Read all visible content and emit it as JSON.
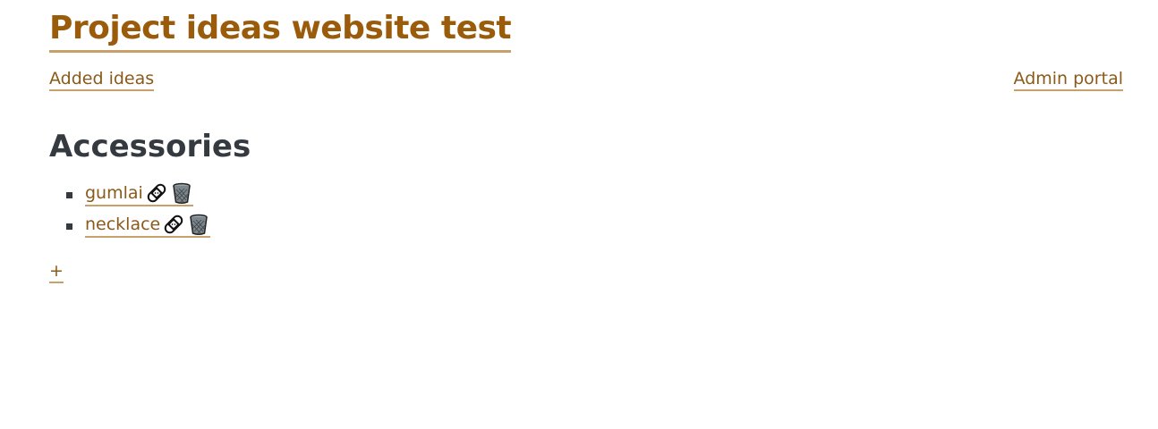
{
  "header": {
    "title": "Project ideas website test"
  },
  "nav": {
    "added_ideas": "Added ideas",
    "admin_portal": "Admin portal"
  },
  "section": {
    "heading": "Accessories",
    "items": [
      {
        "label": "gumlai",
        "edit_icon": "adhesive-bandage-icon",
        "delete_icon": "wastebasket-icon"
      },
      {
        "label": "necklace",
        "edit_icon": "adhesive-bandage-icon",
        "delete_icon": "wastebasket-icon"
      }
    ]
  },
  "add": {
    "label": "+"
  },
  "colors": {
    "title": "#9a5b0b",
    "link": "#8a5a1a",
    "underline": "#c8a06a",
    "text": "#343a40"
  }
}
